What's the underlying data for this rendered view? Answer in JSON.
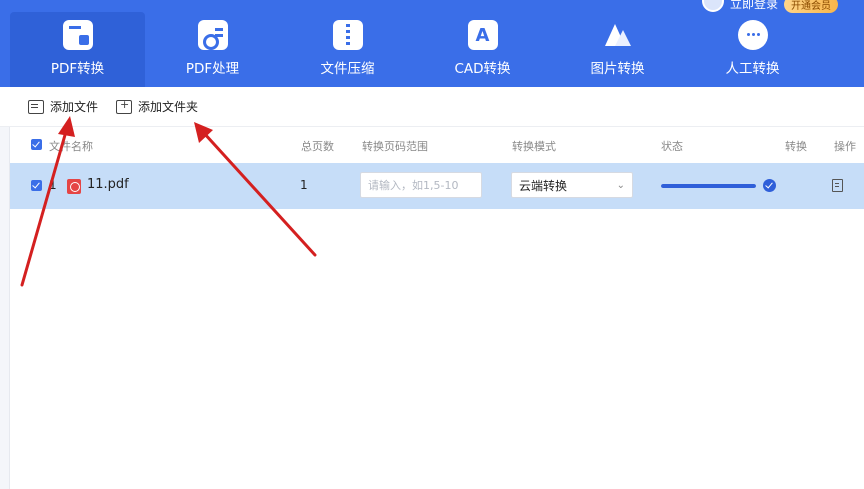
{
  "header": {
    "login_text": "立即登录",
    "vip_badge": "开通会员"
  },
  "tabs": [
    {
      "label": "PDF转换",
      "active": true,
      "icon": "pdf-convert-icon"
    },
    {
      "label": "PDF处理",
      "active": false,
      "icon": "pdf-process-icon"
    },
    {
      "label": "文件压缩",
      "active": false,
      "icon": "zip-icon"
    },
    {
      "label": "CAD转换",
      "active": false,
      "icon": "cad-icon",
      "glyph": "A"
    },
    {
      "label": "图片转换",
      "active": false,
      "icon": "image-icon"
    },
    {
      "label": "人工转换",
      "active": false,
      "icon": "chat-bubble-icon"
    }
  ],
  "toolbar": {
    "add_file": "添加文件",
    "add_folder": "添加文件夹"
  },
  "table": {
    "headers": {
      "name": "文件名称",
      "pages": "总页数",
      "range": "转换页码范围",
      "mode": "转换模式",
      "status": "状态",
      "convert": "转换",
      "action": "操作"
    },
    "rows": [
      {
        "index": "1",
        "file": "11.pdf",
        "pages": "1",
        "range_placeholder": "请输入，如1,5-10",
        "mode": "云端转换",
        "progress": 1.0
      }
    ]
  },
  "colors": {
    "brand_blue": "#3a6ee8",
    "active_tab": "#2f61d8",
    "row_selected": "#c6ddf8",
    "pdf_red": "#e54545",
    "annotation_red": "#d42020"
  }
}
